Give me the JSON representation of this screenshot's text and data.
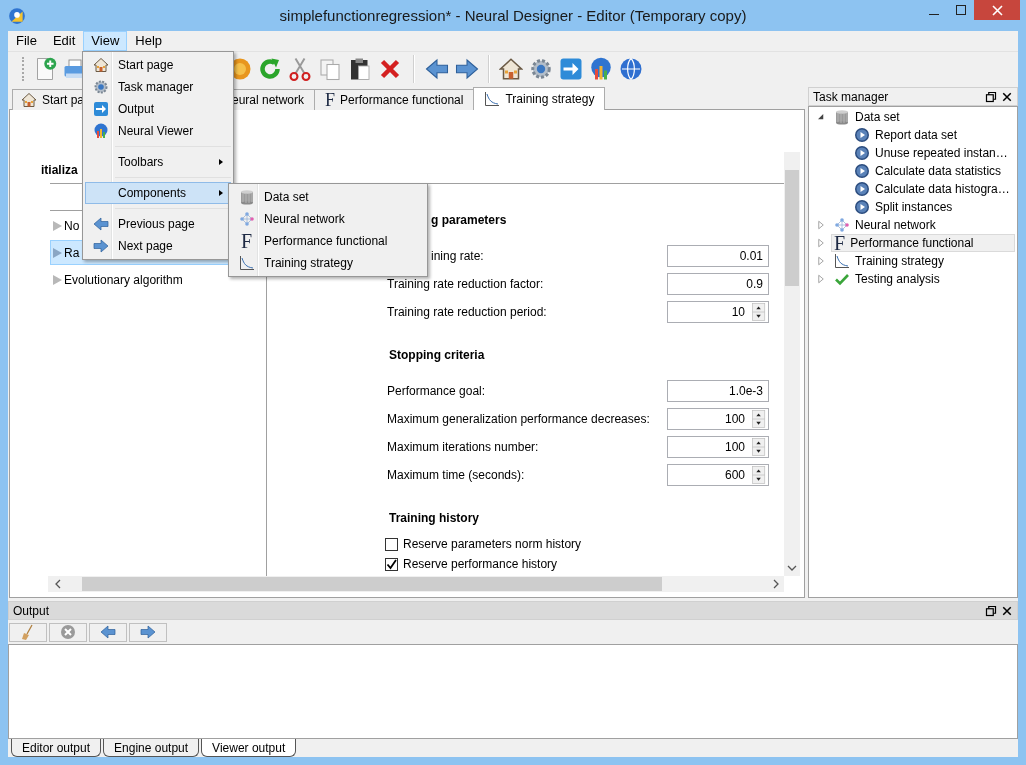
{
  "window": {
    "title": "simplefunctionregression* - Neural Designer - Editor (Temporary copy)"
  },
  "menu_bar": [
    {
      "label": "File",
      "selected": false
    },
    {
      "label": "Edit",
      "selected": false
    },
    {
      "label": "View",
      "selected": true
    },
    {
      "label": "Help",
      "selected": false
    }
  ],
  "view_menu": {
    "groups": [
      [
        {
          "label": "Start page",
          "submenu": false,
          "selected": false
        },
        {
          "label": "Task manager",
          "submenu": false,
          "selected": false
        },
        {
          "label": "Output",
          "submenu": false,
          "selected": false
        },
        {
          "label": "Neural Viewer",
          "submenu": false,
          "selected": false
        }
      ],
      [
        {
          "label": "Toolbars",
          "submenu": true,
          "selected": false
        }
      ],
      [
        {
          "label": "Components",
          "submenu": true,
          "selected": true
        }
      ],
      [
        {
          "label": "Previous page",
          "submenu": false,
          "selected": false
        },
        {
          "label": "Next page",
          "submenu": false,
          "selected": false
        }
      ]
    ]
  },
  "components_submenu": [
    {
      "label": "Data set",
      "selected": false
    },
    {
      "label": "Neural network",
      "selected": false
    },
    {
      "label": "Performance functional",
      "glyph": "F",
      "selected": false
    },
    {
      "label": "Training strategy",
      "selected": false
    }
  ],
  "editor_tabs": [
    {
      "label": "Start pa",
      "selected": false
    },
    {
      "label": "eural network",
      "selected": false
    },
    {
      "label": "Performance functional",
      "glyph": "F",
      "selected": false
    },
    {
      "label": "Training strategy",
      "selected": true
    }
  ],
  "editor": {
    "heading": "itializa",
    "methods": [
      {
        "label": "No",
        "selected": false
      },
      {
        "label": "Ra",
        "selected": true
      },
      {
        "label": "Evolutionary algorithm",
        "selected": false
      }
    ],
    "sections": [
      {
        "title": "g parameters",
        "rows": [
          {
            "kind": "text",
            "label": "ining rate:",
            "value": "0.01"
          },
          {
            "kind": "text",
            "label": "Training rate reduction factor:",
            "value": "0.9"
          },
          {
            "kind": "spin",
            "label": "Training rate reduction period:",
            "value": "10"
          }
        ]
      },
      {
        "title": "Stopping criteria",
        "rows": [
          {
            "kind": "text",
            "label": "Performance goal:",
            "value": "1.0e-3"
          },
          {
            "kind": "spin",
            "label": "Maximum generalization performance decreases:",
            "value": "100"
          },
          {
            "kind": "spin",
            "label": "Maximum iterations number:",
            "value": "100"
          },
          {
            "kind": "spin",
            "label": "Maximum time (seconds):",
            "value": "600"
          }
        ]
      },
      {
        "title": "Training history",
        "rows": [
          {
            "kind": "check",
            "label": "Reserve parameters norm history",
            "checked": false
          },
          {
            "kind": "check",
            "label": "Reserve performance history",
            "checked": true
          }
        ]
      }
    ]
  },
  "task_manager": {
    "title": "Task manager",
    "nodes": [
      {
        "label": "Data set",
        "expanded": true,
        "selected": false,
        "children": [
          {
            "label": "Report data set",
            "selected": false
          },
          {
            "label": "Unuse repeated instan…",
            "selected": false
          },
          {
            "label": "Calculate data statistics",
            "selected": false
          },
          {
            "label": "Calculate data histogra…",
            "selected": false
          },
          {
            "label": "Split instances",
            "selected": false
          }
        ]
      },
      {
        "label": "Neural network",
        "expanded": false,
        "selected": false
      },
      {
        "label": "Performance functional",
        "glyph": "F",
        "expanded": false,
        "selected": true
      },
      {
        "label": "Training strategy",
        "expanded": false,
        "selected": false
      },
      {
        "label": "Testing analysis",
        "expanded": false,
        "selected": false
      }
    ]
  },
  "output": {
    "title": "Output",
    "tabs": [
      {
        "label": "Editor output",
        "selected": false
      },
      {
        "label": "Engine output",
        "selected": false
      },
      {
        "label": "Viewer output",
        "selected": true
      }
    ]
  }
}
